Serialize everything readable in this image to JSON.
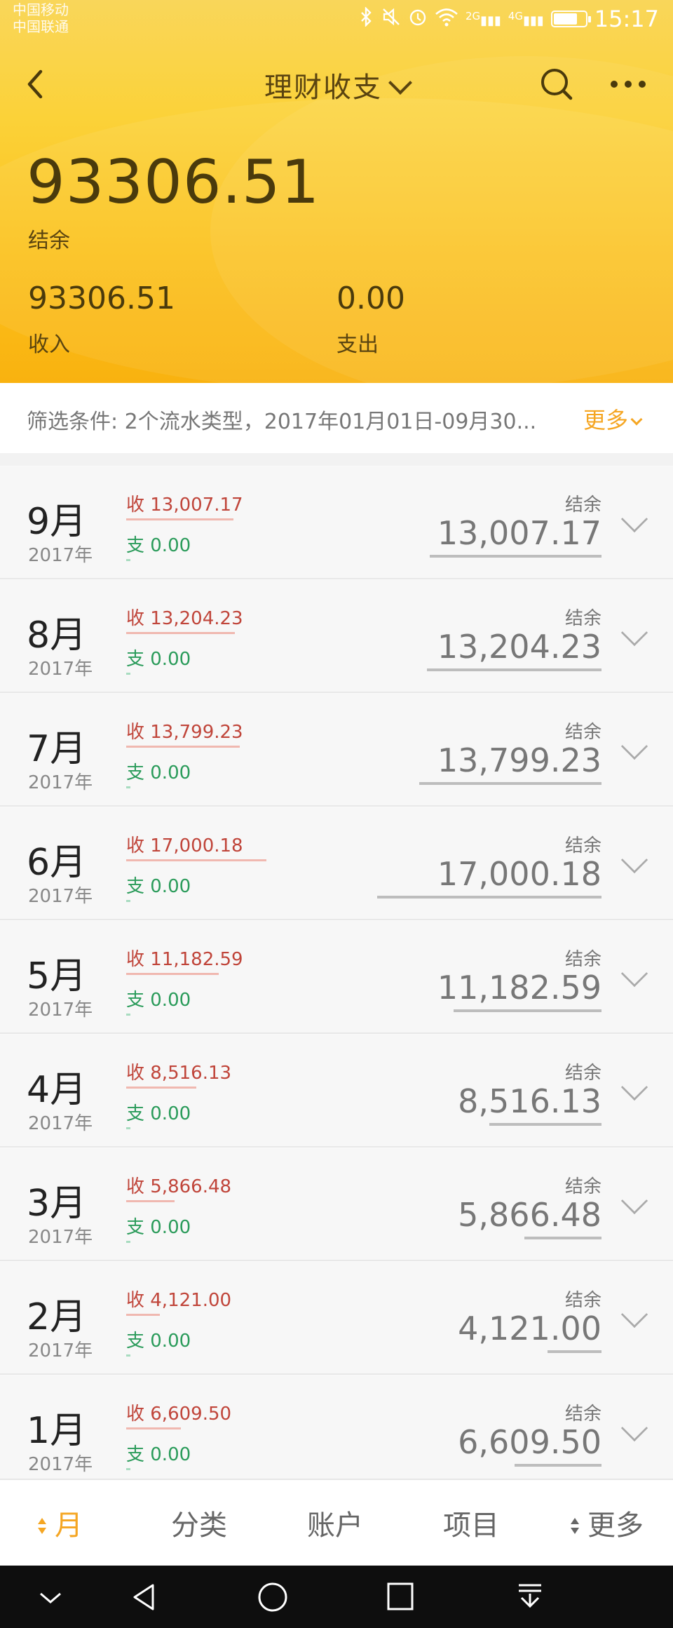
{
  "status_bar": {
    "carrier_1": "中国移动",
    "carrier_2": "中国联通",
    "net_1": "2G",
    "net_2": "4G",
    "time": "15:17"
  },
  "nav": {
    "title": "理财收支"
  },
  "summary": {
    "balance": "93306.51",
    "balance_label": "结余",
    "income": "93306.51",
    "income_label": "收入",
    "expense": "0.00",
    "expense_label": "支出"
  },
  "filter": {
    "text": "筛选条件:  2个流水类型，2017年01月01日-09月30...",
    "more": "更多"
  },
  "rows": [
    {
      "month": "9月",
      "year": "2017年",
      "income": "收 13,007.17",
      "expense": "支 0.00",
      "balance_label": "结余",
      "balance": "13,007.17",
      "bar": 0.765
    },
    {
      "month": "8月",
      "year": "2017年",
      "income": "收 13,204.23",
      "expense": "支 0.00",
      "balance_label": "结余",
      "balance": "13,204.23",
      "bar": 0.777
    },
    {
      "month": "7月",
      "year": "2017年",
      "income": "收 13,799.23",
      "expense": "支 0.00",
      "balance_label": "结余",
      "balance": "13,799.23",
      "bar": 0.812
    },
    {
      "month": "6月",
      "year": "2017年",
      "income": "收 17,000.18",
      "expense": "支 0.00",
      "balance_label": "结余",
      "balance": "17,000.18",
      "bar": 1.0
    },
    {
      "month": "5月",
      "year": "2017年",
      "income": "收 11,182.59",
      "expense": "支 0.00",
      "balance_label": "结余",
      "balance": "11,182.59",
      "bar": 0.658
    },
    {
      "month": "4月",
      "year": "2017年",
      "income": "收 8,516.13",
      "expense": "支 0.00",
      "balance_label": "结余",
      "balance": "8,516.13",
      "bar": 0.501
    },
    {
      "month": "3月",
      "year": "2017年",
      "income": "收 5,866.48",
      "expense": "支 0.00",
      "balance_label": "结余",
      "balance": "5,866.48",
      "bar": 0.345
    },
    {
      "month": "2月",
      "year": "2017年",
      "income": "收 4,121.00",
      "expense": "支 0.00",
      "balance_label": "结余",
      "balance": "4,121.00",
      "bar": 0.242
    },
    {
      "month": "1月",
      "year": "2017年",
      "income": "收 6,609.50",
      "expense": "支 0.00",
      "balance_label": "结余",
      "balance": "6,609.50",
      "bar": 0.389
    }
  ],
  "tabs": [
    "月",
    "分类",
    "账户",
    "项目",
    "更多"
  ],
  "colors": {
    "accent": "#f5a623",
    "income": "#c0453a",
    "expense": "#2a9b5a"
  }
}
